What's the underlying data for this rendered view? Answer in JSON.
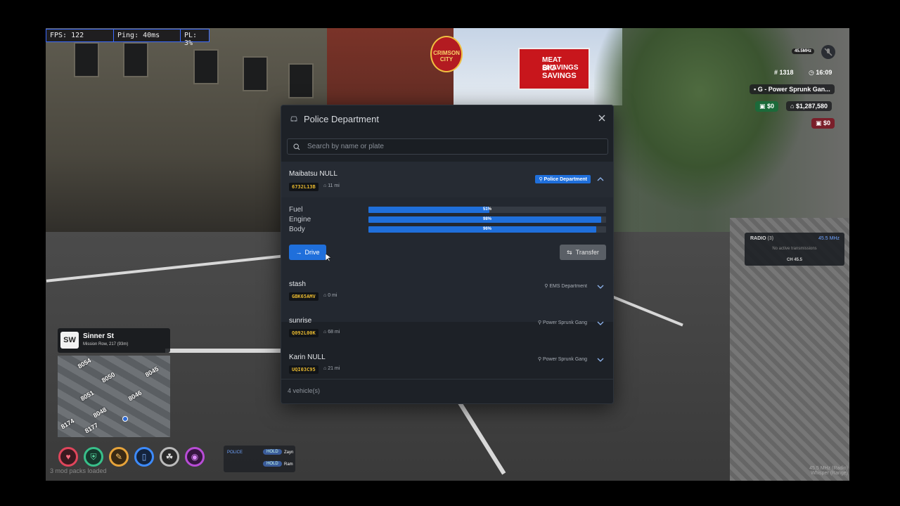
{
  "perf": {
    "fps": "FPS: 122",
    "ping": "Ping: 40ms",
    "pl": "PL: 3%"
  },
  "logo": {
    "line1": "CRIMSON",
    "line2": "CITY"
  },
  "billboard": {
    "line1": "MEAT SHAVINGS",
    "line2": "BIG SAVINGS"
  },
  "hud": {
    "player_id": "1318",
    "time": "16:09",
    "gang": "G - Power Sprunk Gan...",
    "cash": "$0",
    "bank": "$1,287,580",
    "dirty": "$0",
    "voice_range": "45.5MHz"
  },
  "modal": {
    "title": "Police Department",
    "search_placeholder": "Search by name or plate",
    "footer": "4 vehicle(s)",
    "expanded": {
      "name": "Maibatsu NULL",
      "plate": "6732L13B",
      "mileage": "11 mi",
      "department": "Police Department",
      "stats": [
        {
          "label": "Fuel",
          "value": "51%",
          "fraction": 0.51
        },
        {
          "label": "Engine",
          "value": "98%",
          "fraction": 0.98
        },
        {
          "label": "Body",
          "value": "96%",
          "fraction": 0.96
        }
      ],
      "drive_label": "Drive",
      "transfer_label": "Transfer"
    },
    "vehicles": [
      {
        "name": "stash",
        "plate": "GBK65AMV",
        "mileage": "0 mi",
        "department": "EMS Department"
      },
      {
        "name": "sunrise",
        "plate": "Q092L00K",
        "mileage": "68 mi",
        "department": "Power Sprunk Gang"
      },
      {
        "name": "Karin NULL",
        "plate": "UQI03C95",
        "mileage": "21 mi",
        "department": "Power Sprunk Gang"
      }
    ]
  },
  "location": {
    "badge": "SW",
    "street": "Sinner St",
    "area": "Mission Row, 217 (93m)"
  },
  "minimap_labels": [
    "8054",
    "8050",
    "8046",
    "8051",
    "8048",
    "8174",
    "8177",
    "8045"
  ],
  "mods_loaded": "3 mod packs loaded",
  "radio_list": [
    {
      "channel": "POLICE",
      "hold": "HOLD",
      "name": "Zayn"
    },
    {
      "channel": "",
      "hold": "HOLD",
      "name": "Ram"
    }
  ],
  "radio": {
    "title": "RADIO",
    "count": "(3)",
    "freq": "45.5 MHz",
    "status": "No active transmissions",
    "channel": "CH 45.5"
  },
  "bottom_right": {
    "line1": "45.5 MHz (Radio)",
    "line2": "Whisper (Range)"
  },
  "colors": {
    "accent": "#1f6fdb",
    "panel": "#1d2127",
    "plate": "#e7b82f"
  }
}
